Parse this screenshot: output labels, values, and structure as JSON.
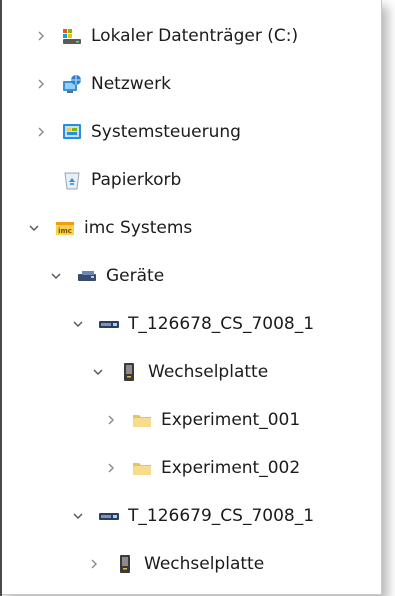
{
  "tree": {
    "items": [
      {
        "label": "Lokaler Datenträger (C:)",
        "icon": "drive-icon",
        "expander": "collapsed"
      },
      {
        "label": "Netzwerk",
        "icon": "network-icon",
        "expander": "collapsed"
      },
      {
        "label": "Systemsteuerung",
        "icon": "control-panel-icon",
        "expander": "collapsed"
      },
      {
        "label": "Papierkorb",
        "icon": "recycle-bin-icon",
        "expander": "none"
      },
      {
        "label": "imc Systems",
        "icon": "imc-icon",
        "expander": "expanded"
      },
      {
        "label": "Geräte",
        "icon": "devices-icon",
        "expander": "expanded"
      },
      {
        "label": "T_126678_CS_7008_1",
        "icon": "device-icon",
        "expander": "expanded"
      },
      {
        "label": "Wechselplatte",
        "icon": "removable-disk-icon",
        "expander": "expanded"
      },
      {
        "label": "Experiment_001",
        "icon": "folder-icon",
        "expander": "collapsed"
      },
      {
        "label": "Experiment_002",
        "icon": "folder-icon",
        "expander": "collapsed"
      },
      {
        "label": "T_126679_CS_7008_1",
        "icon": "device-icon",
        "expander": "expanded"
      },
      {
        "label": "Wechselplatte",
        "icon": "removable-disk-icon",
        "expander": "collapsed"
      }
    ]
  },
  "colors": {
    "text": "#1b1b1b",
    "chevron": "#8a8a8a",
    "folder": "#f2d27a",
    "imc_orange": "#f39c12"
  }
}
